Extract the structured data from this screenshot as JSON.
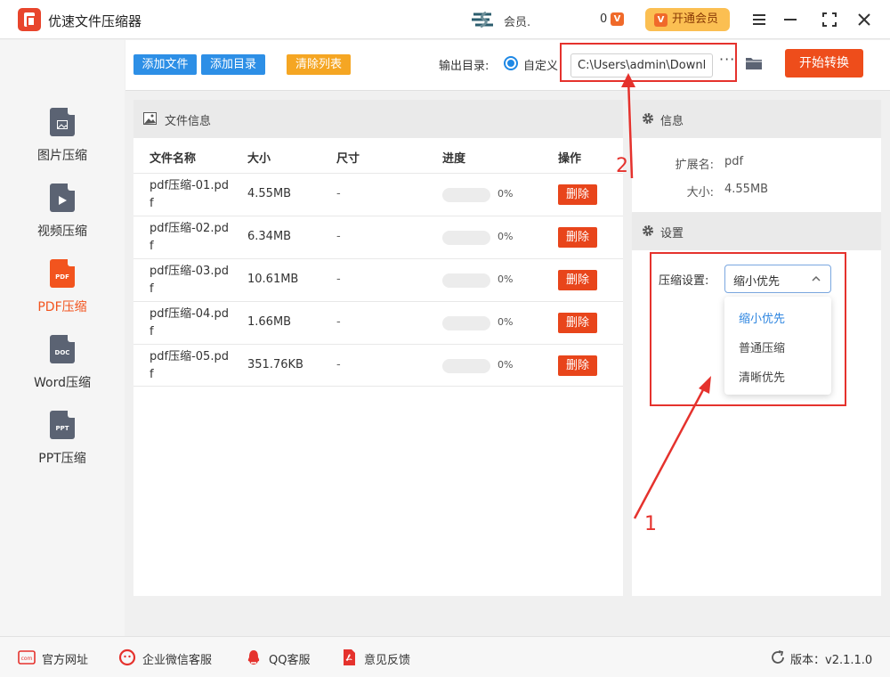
{
  "app": {
    "title": "优速文件压缩器",
    "user_name": "会员.",
    "coins": "0",
    "coin_icon_text": "V",
    "vip_button": "开通会员"
  },
  "sidebar": {
    "items": [
      {
        "label": "图片压缩",
        "tag": "",
        "active": false
      },
      {
        "label": "视频压缩",
        "tag": "",
        "active": false
      },
      {
        "label": "PDF压缩",
        "tag": "PDF",
        "active": true
      },
      {
        "label": "Word压缩",
        "tag": "DOC",
        "active": false
      },
      {
        "label": "PPT压缩",
        "tag": "PPT",
        "active": false
      }
    ]
  },
  "toolbar": {
    "add_file": "添加文件",
    "add_dir": "添加目录",
    "clear_list": "清除列表",
    "output_label": "输出目录:",
    "custom_label": "自定义",
    "output_path": "C:\\Users\\admin\\Downloads",
    "more": "···",
    "start": "开始转换"
  },
  "file_panel": {
    "title": "文件信息",
    "columns": {
      "name": "文件名称",
      "size": "大小",
      "dimension": "尺寸",
      "progress": "进度",
      "action": "操作"
    },
    "rows": [
      {
        "name": "pdf压缩-01.pdf",
        "size": "4.55MB",
        "dimension": "-",
        "progress": 0,
        "progress_text": "0%",
        "action": "删除"
      },
      {
        "name": "pdf压缩-02.pdf",
        "size": "6.34MB",
        "dimension": "-",
        "progress": 0,
        "progress_text": "0%",
        "action": "删除"
      },
      {
        "name": "pdf压缩-03.pdf",
        "size": "10.61MB",
        "dimension": "-",
        "progress": 0,
        "progress_text": "0%",
        "action": "删除"
      },
      {
        "name": "pdf压缩-04.pdf",
        "size": "1.66MB",
        "dimension": "-",
        "progress": 0,
        "progress_text": "0%",
        "action": "删除"
      },
      {
        "name": "pdf压缩-05.pdf",
        "size": "351.76KB",
        "dimension": "-",
        "progress": 0,
        "progress_text": "0%",
        "action": "删除"
      }
    ]
  },
  "info_panel": {
    "title": "信息",
    "ext_label": "扩展名:",
    "ext_value": "pdf",
    "size_label": "大小:",
    "size_value": "4.55MB"
  },
  "settings_panel": {
    "title": "设置",
    "compress_label": "压缩设置:",
    "selected": "缩小优先",
    "options": [
      "缩小优先",
      "普通压缩",
      "清晰优先"
    ]
  },
  "annotations": {
    "num1": "1",
    "num2": "2"
  },
  "footer": {
    "website": "官方网址",
    "wechat": "企业微信客服",
    "qq": "QQ客服",
    "feedback": "意见反馈",
    "version": "版本：v2.1.1.0"
  },
  "colors": {
    "accent_orange": "#ee4d1b",
    "accent_blue": "#1e88e5",
    "annotation_red": "#e5322d",
    "clear_button": "#f5a623"
  }
}
